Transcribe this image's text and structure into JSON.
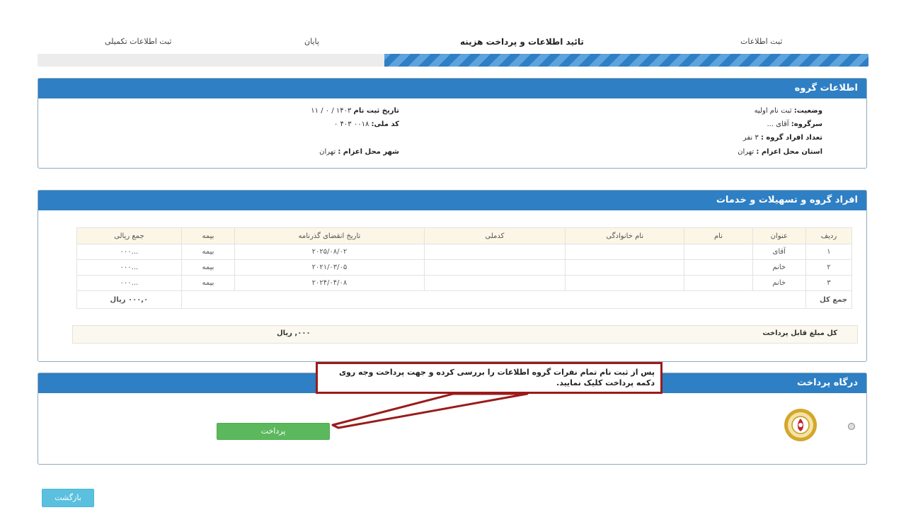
{
  "stepper": {
    "steps": [
      "ثبت اطلاعات",
      "تائید اطلاعات و پرداخت هزینه",
      "پایان",
      "ثبت اطلاعات تکمیلی"
    ],
    "progress_fraction": 0.583
  },
  "group_info": {
    "title": "اطلاعات گروه",
    "status_label": "وضعیت:",
    "status_value": "ثبت نام اولیه",
    "head_label": "سرگروه:",
    "head_value": "آقای  ...",
    "members_count_label": "تعداد افراد گروه :",
    "members_count_value": "۳ نفر",
    "province_label": "استان محل اعزام :",
    "province_value": "تهران",
    "reg_date_label": "تاریخ ثبت نام",
    "reg_date_value": "۱۴۰۳ / ۰ / ۱۱",
    "national_code_label": "کد ملی:",
    "national_code_value": "۰۰۱۸  ۴۰۳  ۰",
    "city_label": "شهر محل اعزام :",
    "city_value": "تهران"
  },
  "members": {
    "title": "افراد گروه و تسهیلات و خدمات",
    "headers": [
      "ردیف",
      "عنوان",
      "نام",
      "نام خانوادگی",
      "کدملی",
      "تاریخ انقضای گذرنامه",
      "بیمه",
      "جمع ریالی"
    ],
    "rows": [
      [
        "۱",
        "آقای",
        "",
        "",
        "",
        "۲۰۲۵/۰۸/۰۲",
        "بیمه",
        "...۰۰۰"
      ],
      [
        "۲",
        "خانم",
        "",
        "",
        "",
        "۲۰۲۱/۰۳/۰۵",
        "بیمه",
        "...۰۰۰"
      ],
      [
        "۳",
        "خانم",
        "",
        "",
        "",
        "۲۰۲۴/۰۴/۰۸",
        "بیمه",
        "...۰۰۰"
      ]
    ],
    "total_label": "جمع کل",
    "total_value": "۰۰۰,۰ ریال",
    "payable_label": "کل مبلغ قابل پرداخت",
    "payable_value": "۰۰۰, ریال"
  },
  "gateway": {
    "title": "درگاه پرداخت",
    "pay_button": "پرداخت",
    "callout_text": "پس از ثبت نام تمام نفرات گروه اطلاعات را بررسی کرده و جهت پرداخت وجه روی دکمه پرداخت کلیک نمایید."
  },
  "back_button": "بازگشت",
  "colors": {
    "header_blue": "#2e7fc3",
    "pay_green": "#5cb85c",
    "back_cyan": "#5bc0de",
    "callout_red": "#9b1b1b"
  }
}
